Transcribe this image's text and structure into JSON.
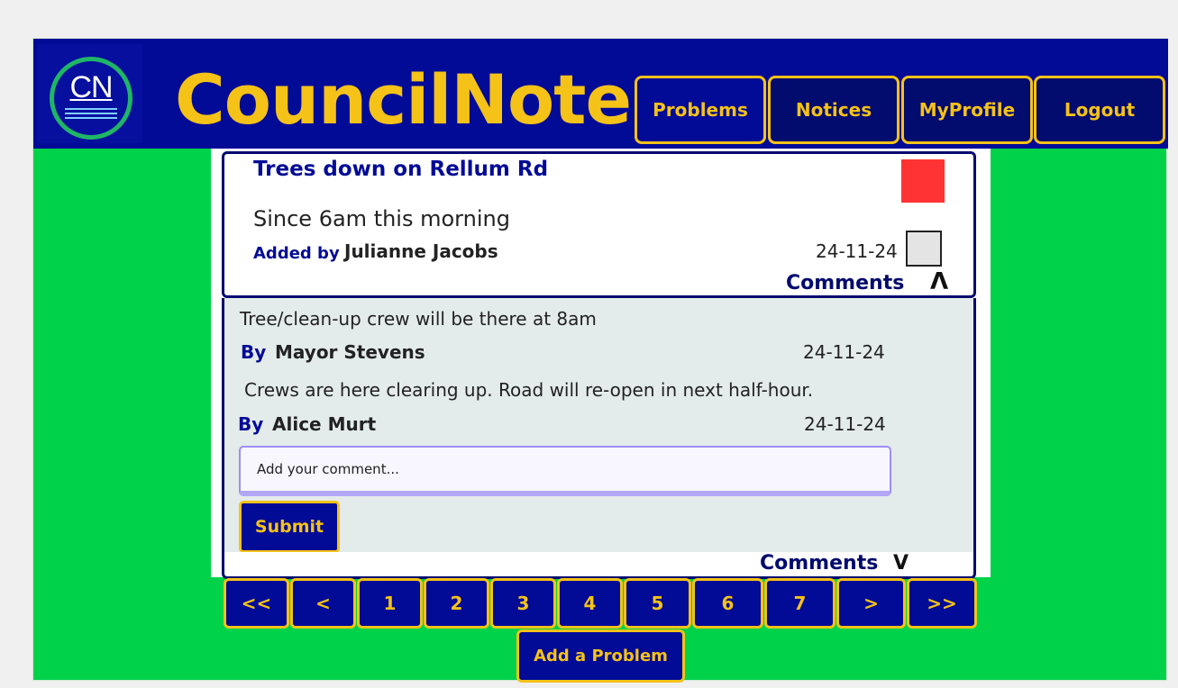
{
  "header": {
    "logo_text": "CN",
    "app_title": "CouncilNote",
    "nav": [
      {
        "label": "Problems"
      },
      {
        "label": "Notices"
      },
      {
        "label": "MyProfile"
      },
      {
        "label": "Logout"
      }
    ]
  },
  "problem": {
    "title": "Trees down on Rellum Rd",
    "status_color": "#ff3333",
    "description": "Since 6am this morning",
    "added_by_label": "Added by",
    "added_by_name": "Julianne Jacobs",
    "date": "24-11-24",
    "comments_label": "Comments",
    "collapse_icon": "Λ"
  },
  "comments": [
    {
      "text": "Tree/clean-up crew will be there at 8am",
      "by_label": "By",
      "author": "Mayor Stevens",
      "date": "24-11-24"
    },
    {
      "text": "Crews are here clearing up. Road will re-open in next half-hour.",
      "by_label": "By",
      "author": "Alice Murt",
      "date": "24-11-24"
    }
  ],
  "comment_form": {
    "placeholder": "Add your comment...",
    "submit_label": "Submit"
  },
  "next_card": {
    "comments_label": "Comments",
    "expand_icon": "V"
  },
  "pagination": [
    "<<",
    "<",
    "1",
    "2",
    "3",
    "4",
    "5",
    "6",
    "7",
    ">",
    ">>"
  ],
  "add_problem_label": "Add a Problem",
  "colors": {
    "header_bg": "#020b96",
    "accent": "#f5c218",
    "page_bg": "#00d34a",
    "status_red": "#ff3333"
  }
}
